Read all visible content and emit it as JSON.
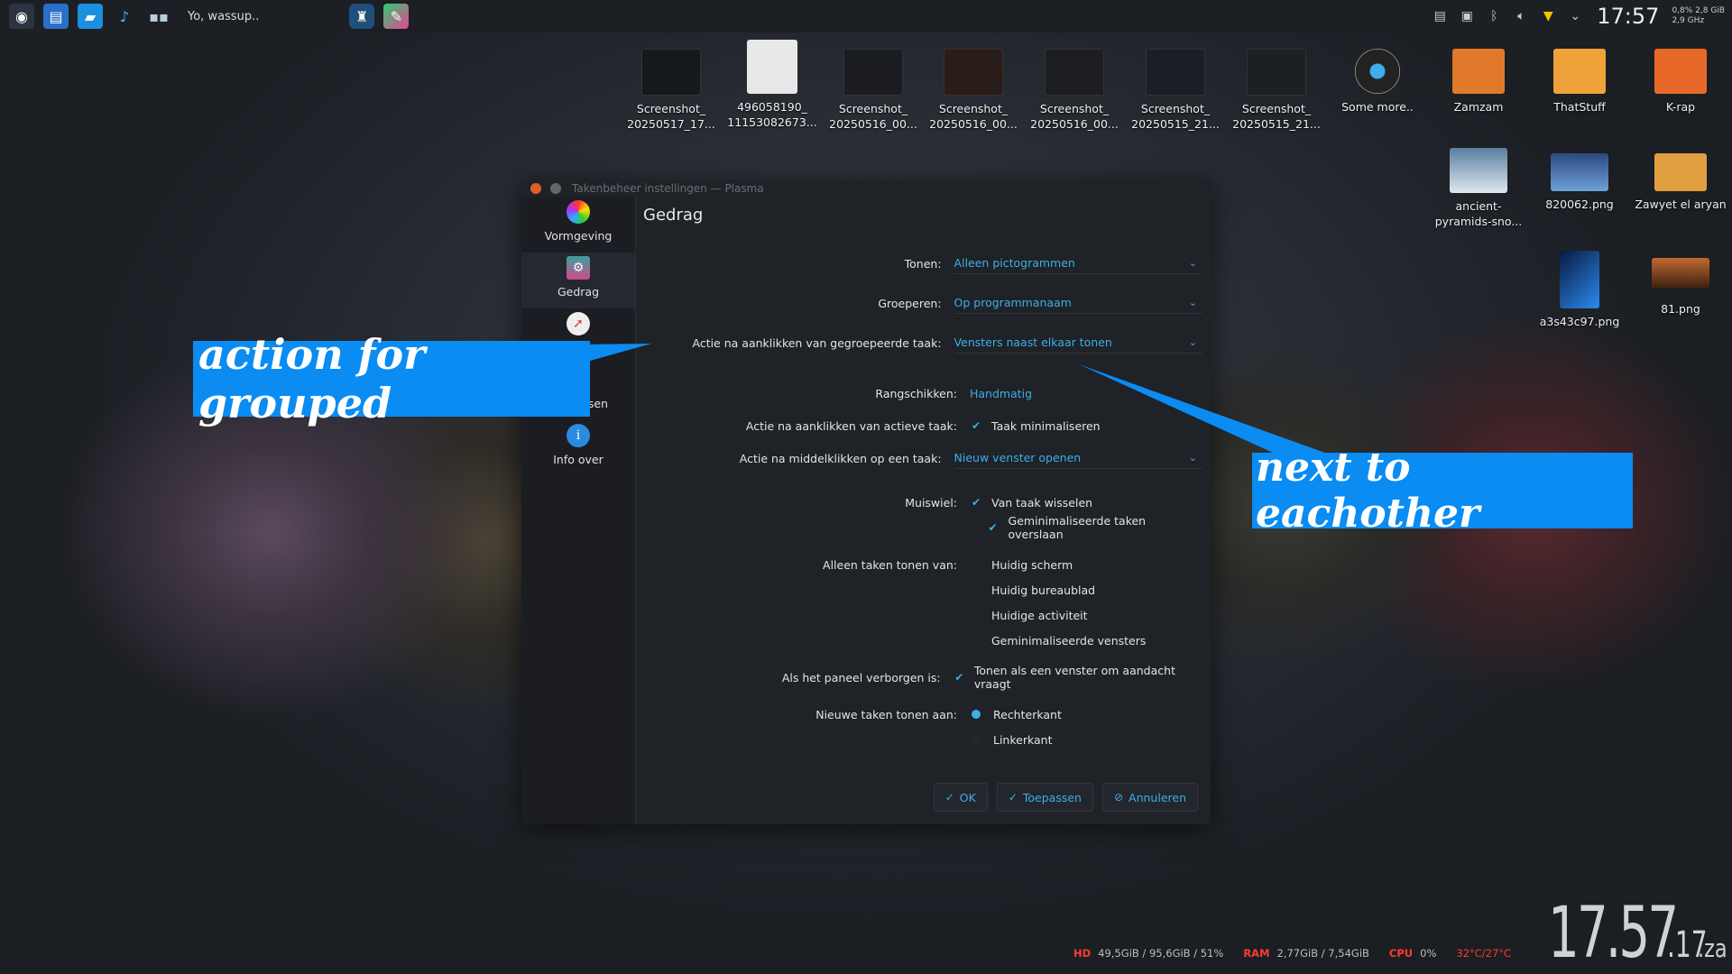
{
  "panel": {
    "window_title": "Yo, wassup..",
    "clock": "17:57",
    "cpu_mini": "0,8% 2,8 GiB",
    "freq_mini": "2,9 GHz"
  },
  "desktop": {
    "icons": [
      {
        "label": "Screenshot_ 20250517_17..."
      },
      {
        "label": "496058190_ 11153082673..."
      },
      {
        "label": "Screenshot_ 20250516_00..."
      },
      {
        "label": "Screenshot_ 20250516_00..."
      },
      {
        "label": "Screenshot_ 20250516_00..."
      },
      {
        "label": "Screenshot_ 20250515_21..."
      },
      {
        "label": "Screenshot_ 20250515_21..."
      },
      {
        "label": "Some more.."
      },
      {
        "label": "Zamzam"
      },
      {
        "label": "ThatStuff"
      },
      {
        "label": "K-rap"
      },
      {
        "label": "ancient-pyramids-sno..."
      },
      {
        "label": "820062.png"
      },
      {
        "label": "Zawyet el aryan"
      },
      {
        "label": "a3s43c97.png"
      },
      {
        "label": "81.png"
      }
    ]
  },
  "dialog": {
    "title": "Takenbeheer instellingen — Plasma",
    "sidebar": [
      {
        "label": "Vormgeving"
      },
      {
        "label": "Gedrag"
      },
      {
        "label": ""
      },
      {
        "label": "sen"
      },
      {
        "label": "Info over"
      }
    ],
    "page_title": "Gedrag",
    "rows": {
      "tonen": {
        "label": "Tonen:",
        "value": "Alleen pictogrammen"
      },
      "groeperen": {
        "label": "Groeperen:",
        "value": "Op programmanaam"
      },
      "actie_groep": {
        "label": "Actie na aanklikken van gegroepeerde taak:",
        "value": "Vensters naast elkaar tonen"
      },
      "rangschikken": {
        "label": "Rangschikken:",
        "value": "Handmatig"
      },
      "actie_actief": {
        "label": "Actie na aanklikken van actieve taak:",
        "value": "Taak minimaliseren"
      },
      "actie_midden": {
        "label": "Actie na middelklikken op een taak:",
        "value": "Nieuw venster openen"
      },
      "muiswiel": {
        "label": "Muiswiel:",
        "opt1": "Van taak wisselen",
        "opt2": "Geminimaliseerde taken overslaan"
      },
      "alleen": {
        "label": "Alleen taken tonen van:",
        "opt1": "Huidig scherm",
        "opt2": "Huidig bureaublad",
        "opt3": "Huidige activiteit",
        "opt4": "Geminimaliseerde vensters"
      },
      "verborgen": {
        "label": "Als het paneel verborgen is:",
        "opt1": "Tonen als een venster om aandacht vraagt"
      },
      "nieuwe": {
        "label": "Nieuwe taken tonen aan:",
        "opt1": "Rechterkant",
        "opt2": "Linkerkant"
      }
    },
    "buttons": {
      "ok": "OK",
      "apply": "Toepassen",
      "cancel": "Annuleren"
    }
  },
  "annotations": {
    "left": "action for grouped",
    "right": "next to eachother"
  },
  "stats": {
    "hd_key": "HD",
    "hd_val": "49,5GiB / 95,6GiB / 51%",
    "ram_key": "RAM",
    "ram_val": "2,77GiB / 7,54GiB",
    "cpu_key": "CPU",
    "cpu_val": "0%",
    "temp_val": "32°C/27°C"
  },
  "bigclock": {
    "hm": "17.57",
    "sec": ".17",
    "day": ".za"
  },
  "colors": {
    "accent": "#3daee9",
    "annotation": "#0a8cf2",
    "stat_key": "#ff3b30"
  }
}
